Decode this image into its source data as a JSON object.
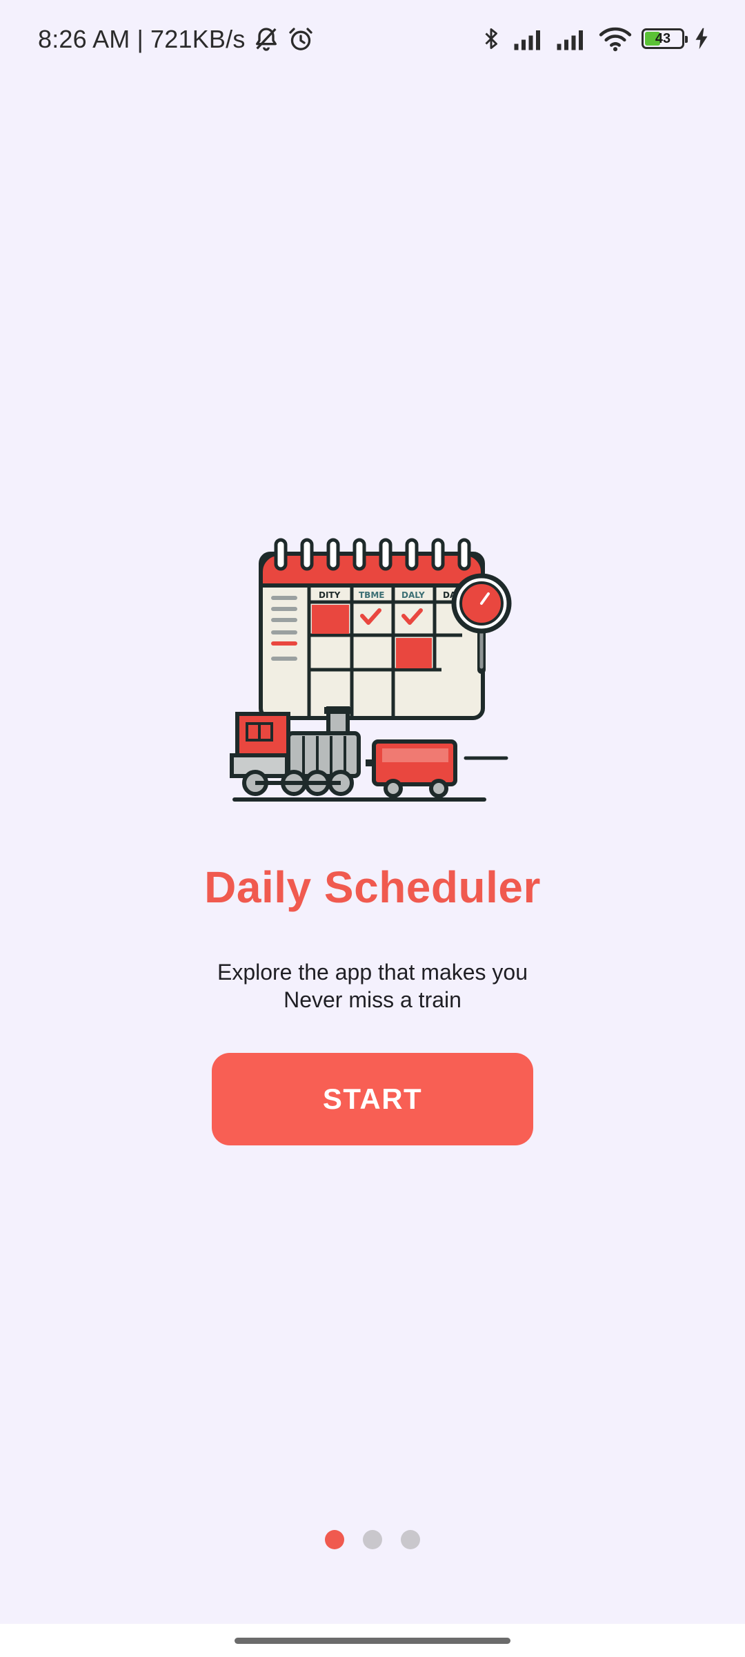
{
  "status_bar": {
    "time": "8:26 AM",
    "separator": "|",
    "network_speed": "721KB/s",
    "battery_level": "43",
    "battery_fraction": 0.43,
    "icons": [
      "mute-bell-icon",
      "alarm-icon",
      "bluetooth-icon",
      "signal-icon",
      "signal-icon",
      "wifi-icon",
      "battery-icon",
      "charging-icon"
    ]
  },
  "onboarding": {
    "illustration_labels": [
      "DITY",
      "TBME",
      "DALY",
      "DAY"
    ],
    "title": "Daily Scheduler",
    "subtitle_line1": "Explore the app that makes you",
    "subtitle_line2": "Never miss a train",
    "start_label": "START"
  },
  "pager": {
    "total": 3,
    "active_index": 0
  },
  "colors": {
    "accent": "#F05A4F",
    "button": "#F85F54",
    "background": "#F4F1FD",
    "dot_inactive": "#C9C7CC"
  }
}
